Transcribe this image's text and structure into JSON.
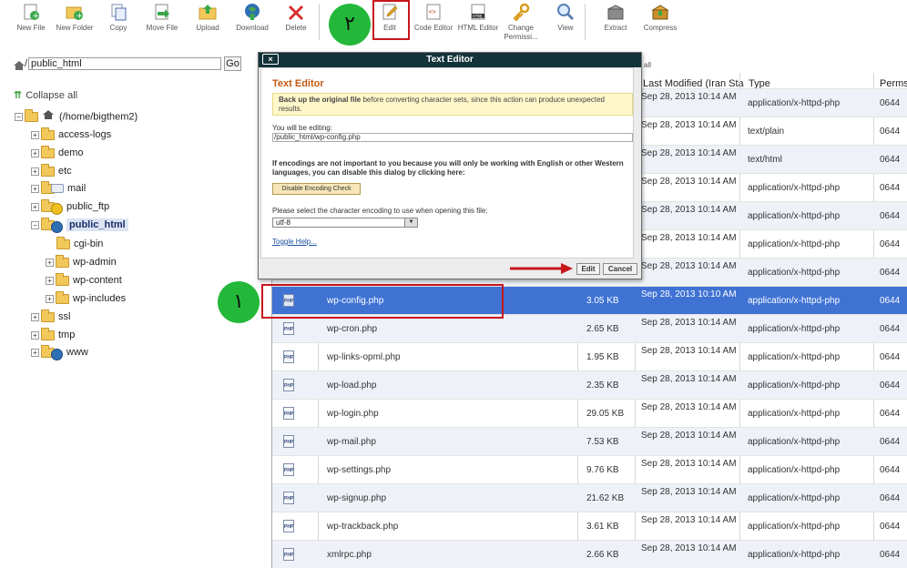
{
  "toolbar": {
    "items": [
      {
        "label": "New File",
        "icon": "new-file-icon"
      },
      {
        "label": "New Folder",
        "icon": "new-folder-icon"
      },
      {
        "label": "Copy",
        "icon": "copy-icon"
      },
      {
        "label": "Move File",
        "icon": "move-file-icon"
      },
      {
        "label": "Upload",
        "icon": "upload-icon"
      },
      {
        "label": "Download",
        "icon": "download-icon"
      },
      {
        "label": "Delete",
        "icon": "delete-icon"
      },
      {
        "label": "Edit",
        "icon": "edit-icon"
      },
      {
        "label": "Code Editor",
        "icon": "code-editor-icon"
      },
      {
        "label": "HTML Editor",
        "icon": "html-editor-icon"
      },
      {
        "label": "Change Permissi...",
        "icon": "permissions-key-icon"
      },
      {
        "label": "View",
        "icon": "view-magnifier-icon"
      },
      {
        "label": "Extract",
        "icon": "extract-icon"
      },
      {
        "label": "Compress",
        "icon": "compress-icon"
      }
    ]
  },
  "path": {
    "value": "public_html",
    "go_label": "Go"
  },
  "tree": {
    "collapse_label": "Collapse all",
    "root_label": "(/home/bigthem2)",
    "items": [
      "access-logs",
      "demo",
      "etc",
      "mail",
      "public_ftp",
      "public_html",
      "cgi-bin",
      "wp-admin",
      "wp-content",
      "wp-includes",
      "ssl",
      "tmp",
      "www"
    ]
  },
  "table": {
    "header_partial": "all",
    "columns": [
      "Last Modified (Iran Sta",
      "Type",
      "Perms"
    ],
    "top_rows": [
      {
        "modified": "Sep 28, 2013 10:14 AM",
        "type": "application/x-httpd-php",
        "perms": "0644"
      },
      {
        "modified": "Sep 28, 2013 10:14 AM",
        "type": "text/plain",
        "perms": "0644"
      },
      {
        "modified": "Sep 28, 2013 10:14 AM",
        "type": "text/html",
        "perms": "0644"
      },
      {
        "modified": "Sep 28, 2013 10:14 AM",
        "type": "application/x-httpd-php",
        "perms": "0644"
      },
      {
        "modified": "Sep 28, 2013 10:14 AM",
        "type": "application/x-httpd-php",
        "perms": "0644"
      },
      {
        "modified": "Sep 28, 2013 10:14 AM",
        "type": "application/x-httpd-php",
        "perms": "0644"
      },
      {
        "modified": "Sep 28, 2013 10:14 AM",
        "type": "application/x-httpd-php",
        "perms": "0644"
      }
    ],
    "rows": [
      {
        "name": "wp-config.php",
        "size": "3.05 KB",
        "modified": "Sep 28, 2013 10:10 AM",
        "type": "application/x-httpd-php",
        "perms": "0644"
      },
      {
        "name": "wp-cron.php",
        "size": "2.65 KB",
        "modified": "Sep 28, 2013 10:14 AM",
        "type": "application/x-httpd-php",
        "perms": "0644"
      },
      {
        "name": "wp-links-opml.php",
        "size": "1.95 KB",
        "modified": "Sep 28, 2013 10:14 AM",
        "type": "application/x-httpd-php",
        "perms": "0644"
      },
      {
        "name": "wp-load.php",
        "size": "2.35 KB",
        "modified": "Sep 28, 2013 10:14 AM",
        "type": "application/x-httpd-php",
        "perms": "0644"
      },
      {
        "name": "wp-login.php",
        "size": "29.05 KB",
        "modified": "Sep 28, 2013 10:14 AM",
        "type": "application/x-httpd-php",
        "perms": "0644"
      },
      {
        "name": "wp-mail.php",
        "size": "7.53 KB",
        "modified": "Sep 28, 2013 10:14 AM",
        "type": "application/x-httpd-php",
        "perms": "0644"
      },
      {
        "name": "wp-settings.php",
        "size": "9.76 KB",
        "modified": "Sep 28, 2013 10:14 AM",
        "type": "application/x-httpd-php",
        "perms": "0644"
      },
      {
        "name": "wp-signup.php",
        "size": "21.62 KB",
        "modified": "Sep 28, 2013 10:14 AM",
        "type": "application/x-httpd-php",
        "perms": "0644"
      },
      {
        "name": "wp-trackback.php",
        "size": "3.61 KB",
        "modified": "Sep 28, 2013 10:14 AM",
        "type": "application/x-httpd-php",
        "perms": "0644"
      },
      {
        "name": "xmlrpc.php",
        "size": "2.66 KB",
        "modified": "Sep 28, 2013 10:14 AM",
        "type": "application/x-httpd-php",
        "perms": "0644"
      }
    ],
    "php_icon_text": "PHP"
  },
  "dialog": {
    "title": "Text Editor",
    "close_label": "×",
    "heading": "Text Editor",
    "warning_bold": "Back up the original file",
    "warning_rest": " before converting character sets, since this action can produce unexpected results.",
    "editing_label": "You will be editing:",
    "editing_path": "/public_html/wp-config.php",
    "encoding_note": "If encodings are not important to you because you will only be working with English or other Western languages, you can disable this dialog by clicking here:",
    "disable_button": "Disable Encoding Check",
    "select_label": "Please select the character encoding to use when opening this file:",
    "encoding_value": "utf-8",
    "toggle_help": "Toggle Help...",
    "edit_button": "Edit",
    "cancel_button": "Cancel"
  },
  "annotations": {
    "step_one": "۱",
    "step_two": "۲"
  },
  "colors": {
    "selected_row": "#3f72d3",
    "dialog_title": "#13323a",
    "annotation_green": "#23b83a",
    "annotation_red": "#c8161d"
  }
}
